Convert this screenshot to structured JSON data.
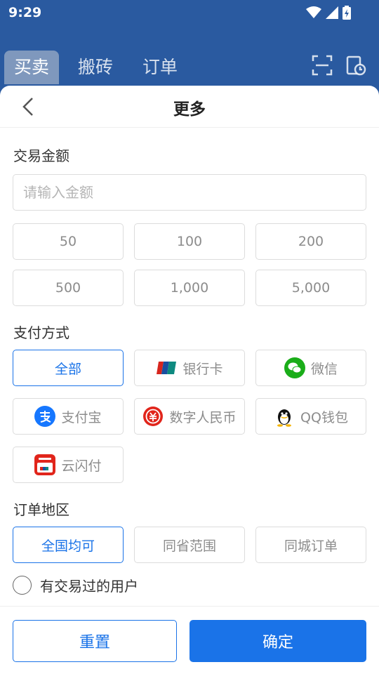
{
  "status_bar": {
    "time": "9:29"
  },
  "colors": {
    "header_bg": "#2a5aa0",
    "accent": "#1a73e8",
    "active_tab_bg": "#7f98bd"
  },
  "top_tabs": [
    {
      "label": "买卖",
      "active": true
    },
    {
      "label": "搬砖",
      "active": false
    },
    {
      "label": "订单",
      "active": false
    }
  ],
  "top_icons": [
    "scan-icon",
    "order-history-icon"
  ],
  "sheet": {
    "title": "更多",
    "amount_section": {
      "label": "交易金额",
      "placeholder": "请输入金额",
      "presets": [
        "50",
        "100",
        "200",
        "500",
        "1,000",
        "5,000"
      ]
    },
    "payment_section": {
      "label": "支付方式",
      "options": [
        {
          "label": "全部",
          "icon": "",
          "selected": true
        },
        {
          "label": "银行卡",
          "icon": "unionpay-icon",
          "selected": false
        },
        {
          "label": "微信",
          "icon": "wechat-icon",
          "selected": false
        },
        {
          "label": "支付宝",
          "icon": "alipay-icon",
          "selected": false
        },
        {
          "label": "数字人民币",
          "icon": "digital-rmb-icon",
          "selected": false
        },
        {
          "label": "QQ钱包",
          "icon": "qq-wallet-icon",
          "selected": false
        },
        {
          "label": "云闪付",
          "icon": "cloud-quickpass-icon",
          "selected": false
        }
      ]
    },
    "region_section": {
      "label": "订单地区",
      "options": [
        {
          "label": "全国均可",
          "selected": true
        },
        {
          "label": "同省范围",
          "selected": false
        },
        {
          "label": "同城订单",
          "selected": false
        }
      ]
    },
    "traded_users_label": "有交易过的用户",
    "reset_label": "重置",
    "confirm_label": "确定"
  }
}
